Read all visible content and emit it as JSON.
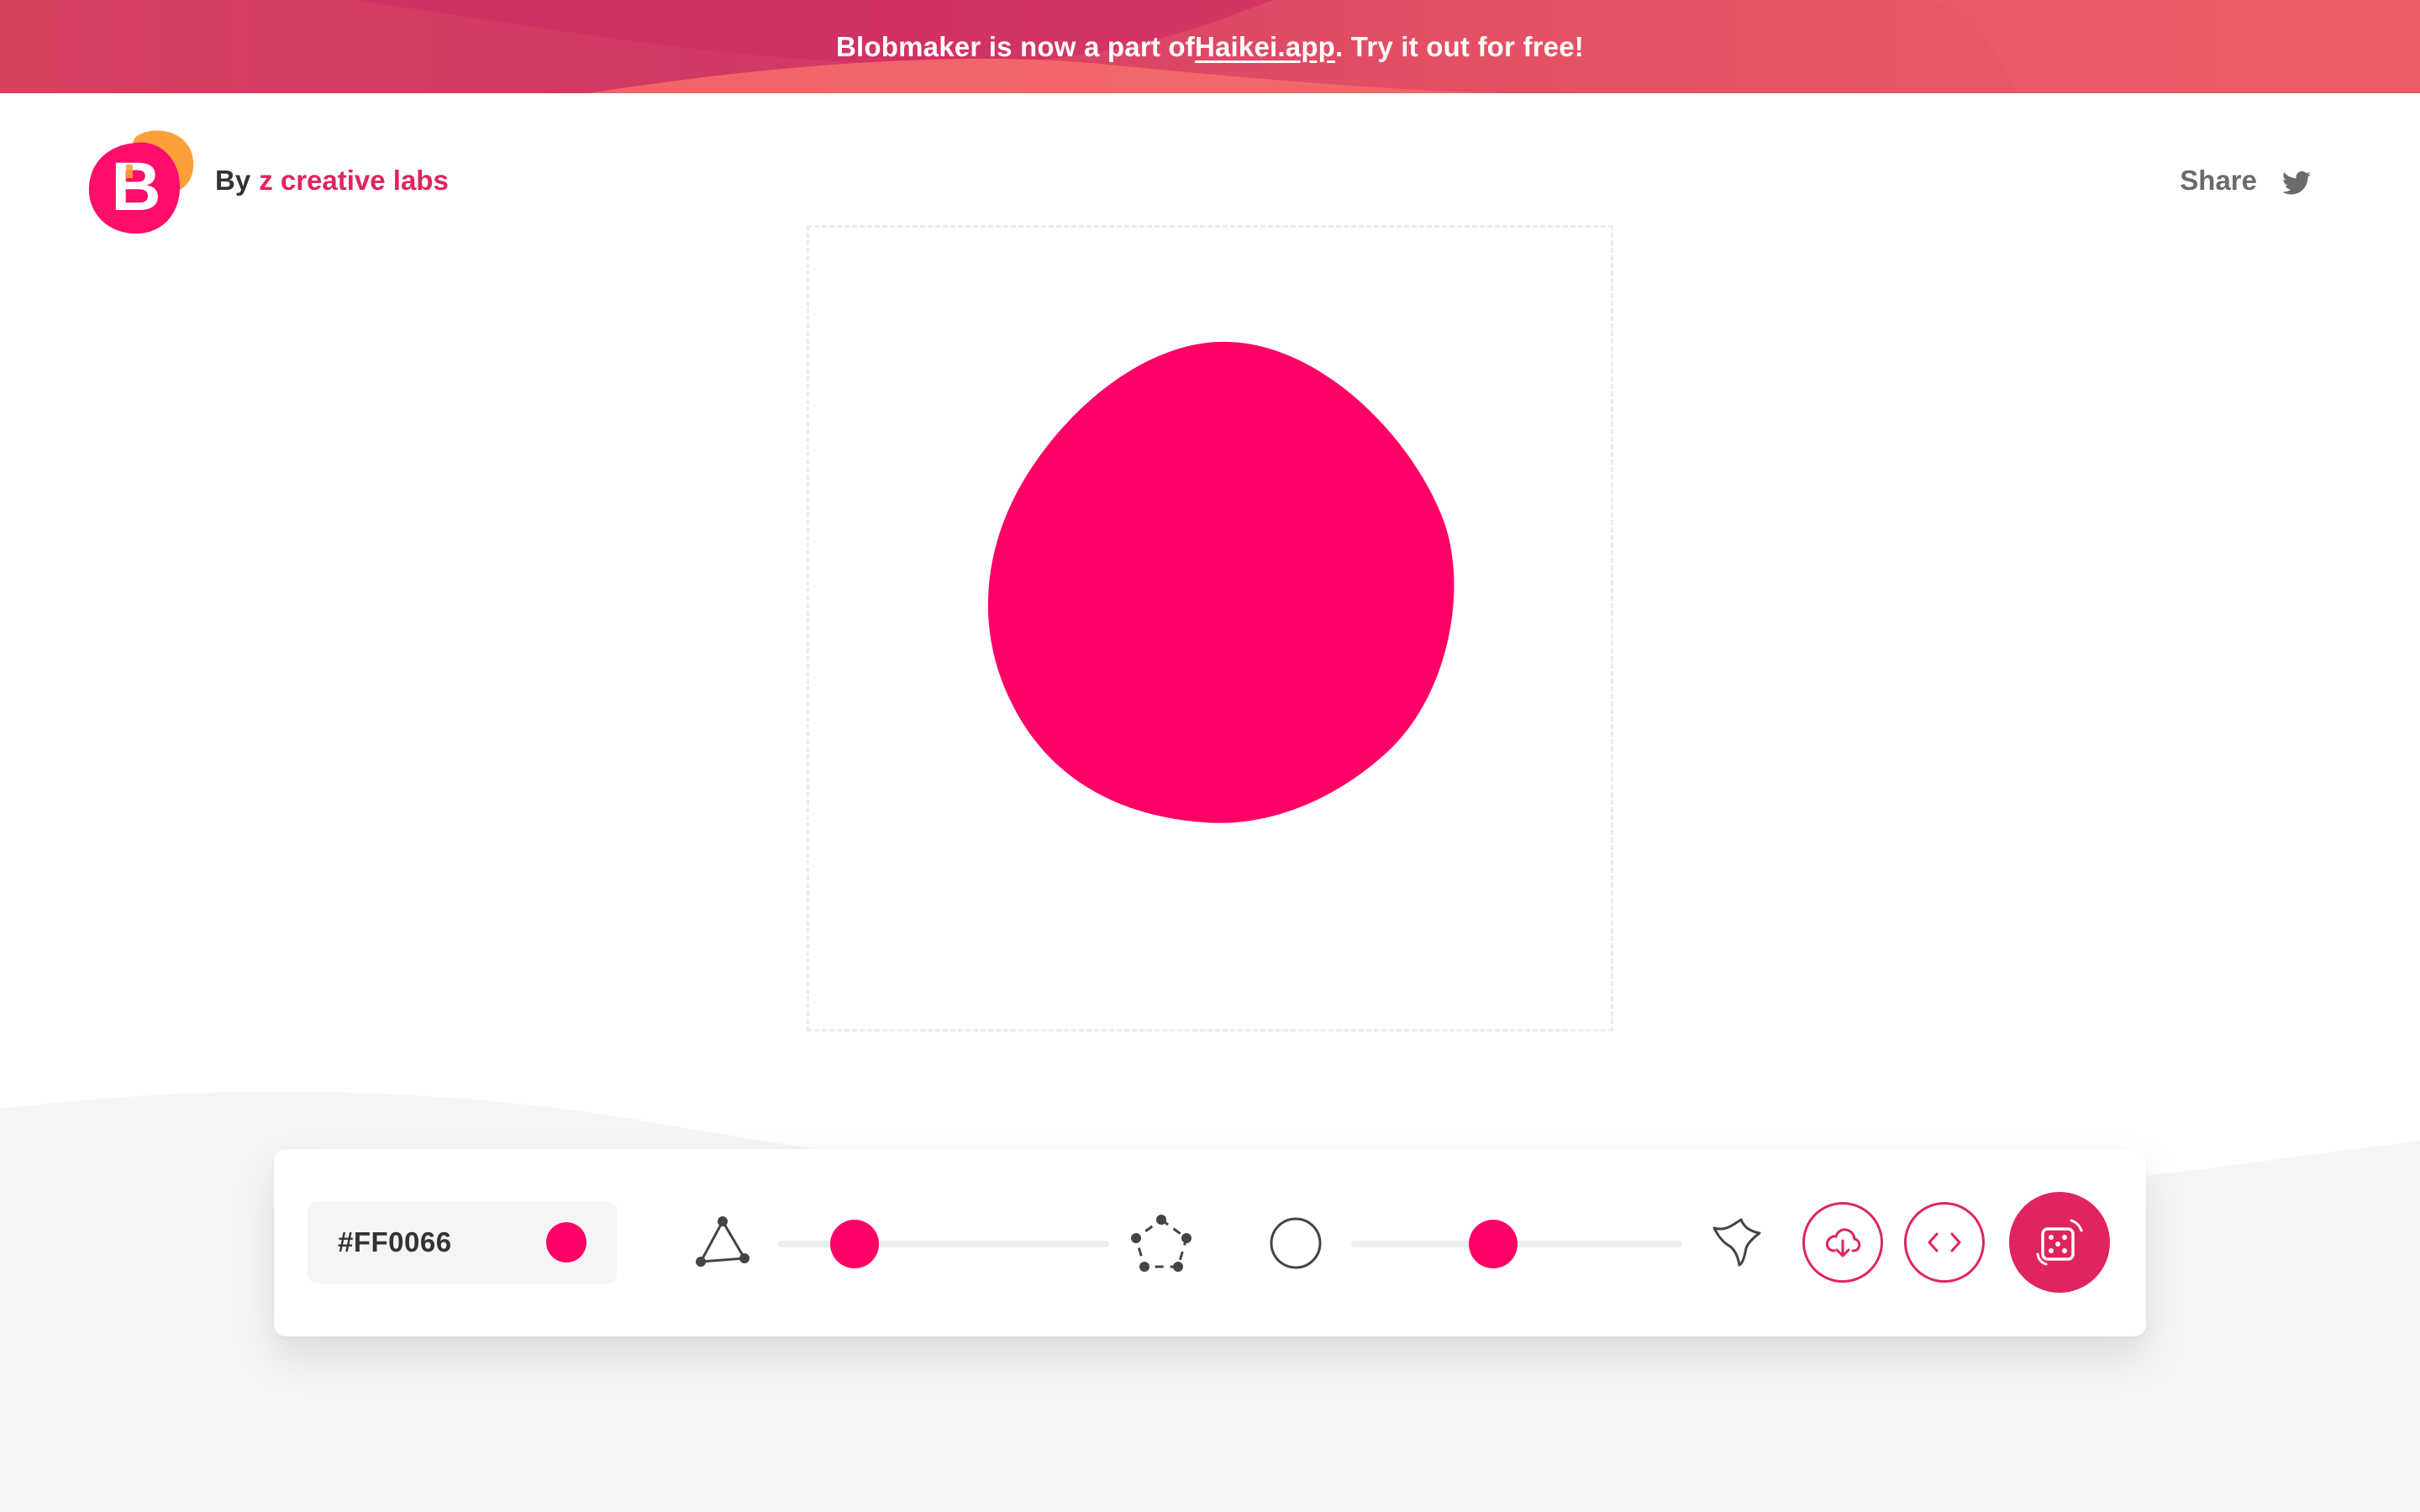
{
  "banner": {
    "text_before": "Blobmaker is now a part of ",
    "link_text": "Haikei.app",
    "text_after": ". Try it out for free!"
  },
  "header": {
    "by_label": "By",
    "brand_label": "z creative labs",
    "share_label": "Share",
    "share_icon": "twitter-icon",
    "logo_letter": "B"
  },
  "blob": {
    "fill": "#FF0066"
  },
  "controls": {
    "color_value": "#FF0066",
    "complexity": {
      "min_icon": "triangle-nodes-icon",
      "max_icon": "pentagon-nodes-icon",
      "value": 0.23
    },
    "contrast": {
      "min_icon": "circle-icon",
      "max_icon": "spiky-blob-icon",
      "value": 0.43
    },
    "download_icon": "cloud-download-icon",
    "code_icon": "code-icon",
    "randomize_icon": "dice-icon"
  },
  "colors": {
    "accent": "#E0245E",
    "blob": "#FF0066",
    "banner": "#D8405F"
  }
}
